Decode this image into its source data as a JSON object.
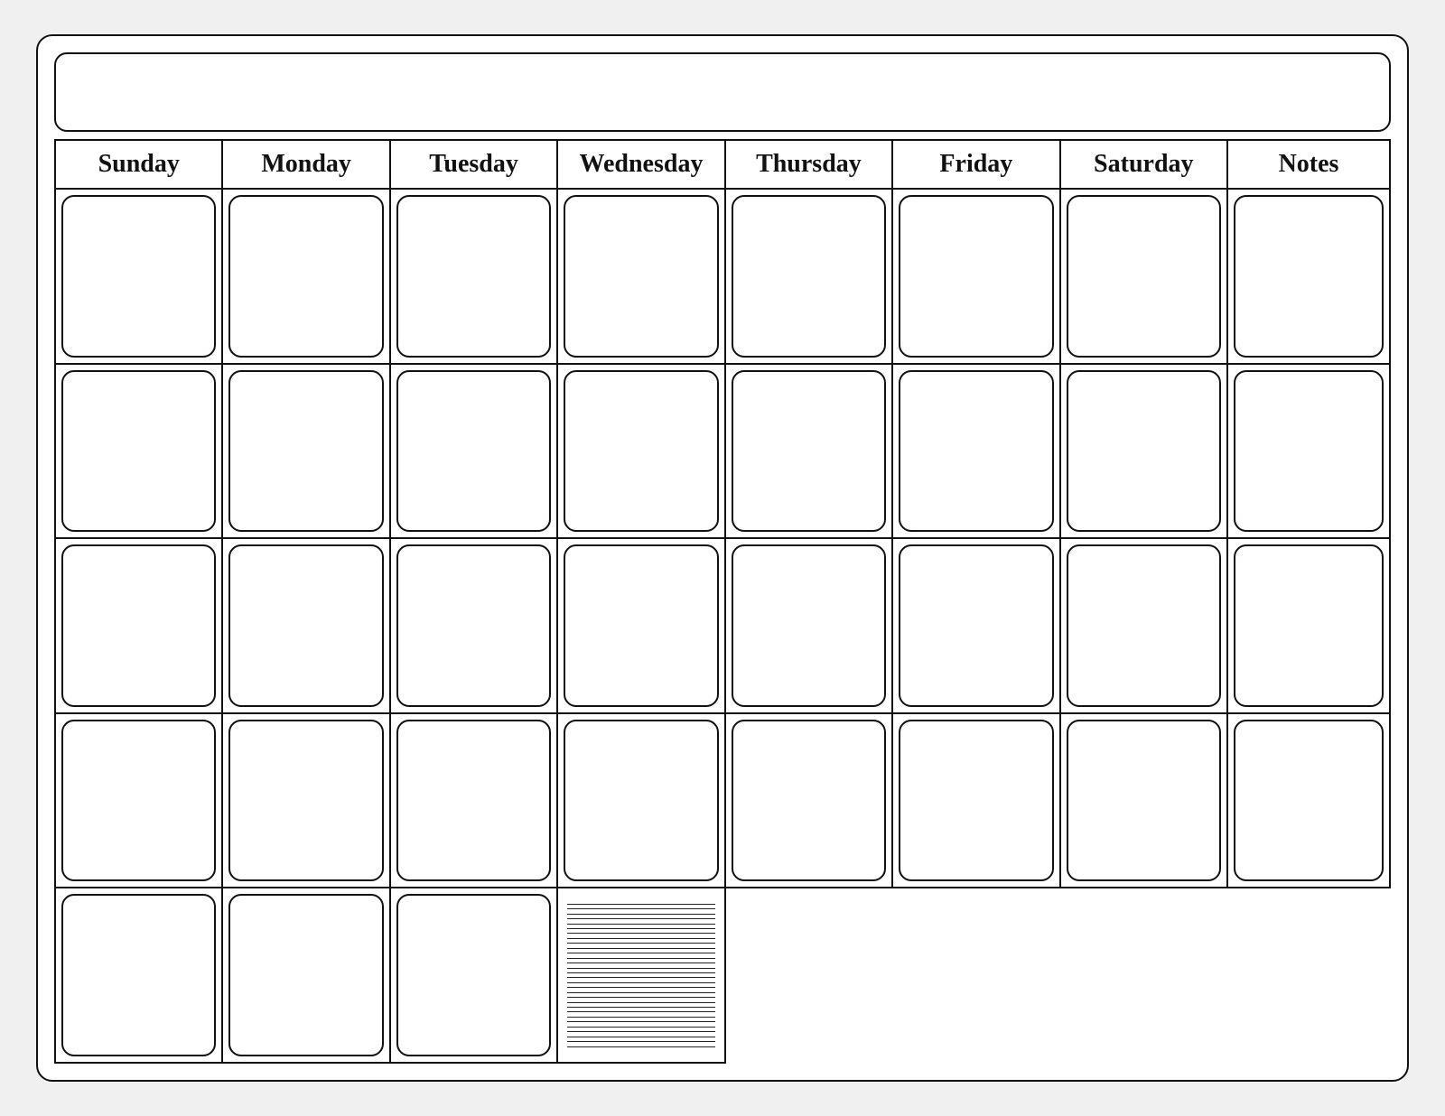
{
  "calendar": {
    "title": "",
    "days": [
      {
        "label": "Sunday"
      },
      {
        "label": "Monday"
      },
      {
        "label": "Tuesday"
      },
      {
        "label": "Wednesday"
      },
      {
        "label": "Thursday"
      },
      {
        "label": "Friday"
      },
      {
        "label": "Saturday"
      }
    ],
    "notes_label": "Notes",
    "weeks": 5,
    "days_per_week": 7,
    "note_lines": 30
  }
}
